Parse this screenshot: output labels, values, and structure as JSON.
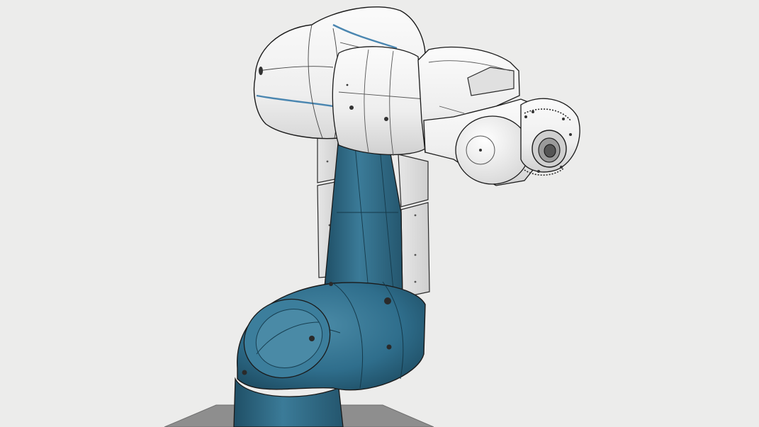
{
  "viewport": {
    "background_color": "#ececeb",
    "render_style": "shaded-with-edges"
  },
  "model": {
    "kind": "robot-arm",
    "colors": {
      "arm_teal": "#2f6e8c",
      "arm_teal_dark": "#1f4f66",
      "arm_teal_light": "#4a8aa6",
      "cover_white": "#f4f4f4",
      "cover_shade": "#d9d9d9",
      "edge_line": "#2a2a2a",
      "pedestal_gray": "#8e8e8e",
      "accent_blue": "#4a86b0"
    }
  }
}
